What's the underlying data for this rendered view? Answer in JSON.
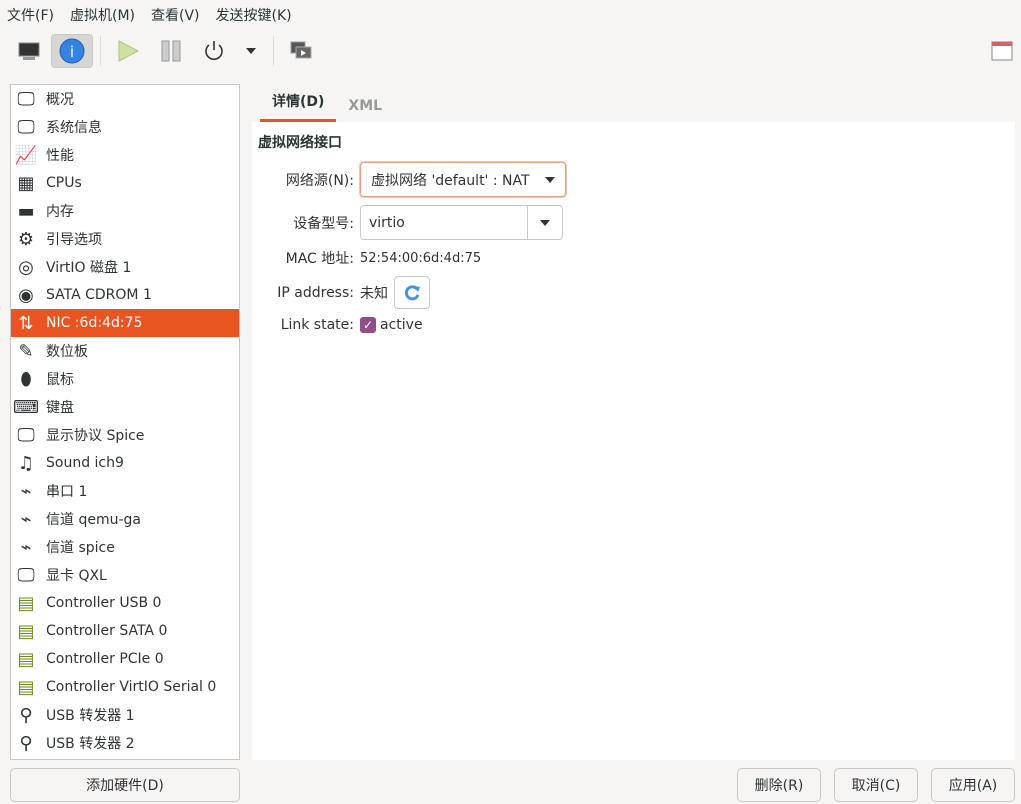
{
  "menu": [
    "文件(F)",
    "虚拟机(M)",
    "查看(V)",
    "发送按键(K)"
  ],
  "sidebar": {
    "items": [
      {
        "label": "概况",
        "icon": "monitor-icon"
      },
      {
        "label": "系统信息",
        "icon": "monitor-icon"
      },
      {
        "label": "性能",
        "icon": "performance-icon"
      },
      {
        "label": "CPUs",
        "icon": "cpu-icon"
      },
      {
        "label": "内存",
        "icon": "memory-icon"
      },
      {
        "label": "引导选项",
        "icon": "gears-icon"
      },
      {
        "label": "VirtIO 磁盘 1",
        "icon": "disk-icon"
      },
      {
        "label": "SATA CDROM 1",
        "icon": "cdrom-icon"
      },
      {
        "label": "NIC :6d:4d:75",
        "icon": "network-icon",
        "selected": true
      },
      {
        "label": "数位板",
        "icon": "tablet-icon"
      },
      {
        "label": "鼠标",
        "icon": "mouse-icon"
      },
      {
        "label": "键盘",
        "icon": "keyboard-icon"
      },
      {
        "label": "显示协议 Spice",
        "icon": "monitor-icon"
      },
      {
        "label": "Sound ich9",
        "icon": "sound-icon"
      },
      {
        "label": "串口 1",
        "icon": "serial-icon"
      },
      {
        "label": "信道 qemu-ga",
        "icon": "serial-icon"
      },
      {
        "label": "信道 spice",
        "icon": "serial-icon"
      },
      {
        "label": "显卡 QXL",
        "icon": "monitor-icon"
      },
      {
        "label": "Controller USB 0",
        "icon": "controller-icon"
      },
      {
        "label": "Controller SATA 0",
        "icon": "controller-icon"
      },
      {
        "label": "Controller PCIe 0",
        "icon": "controller-icon"
      },
      {
        "label": "Controller VirtIO Serial 0",
        "icon": "controller-icon"
      },
      {
        "label": "USB 转发器 1",
        "icon": "usb-icon"
      },
      {
        "label": "USB 转发器 2",
        "icon": "usb-icon"
      }
    ]
  },
  "add_hardware": "添加硬件(D)",
  "tabs": [
    "详情(D)",
    "XML"
  ],
  "details": {
    "heading": "虚拟网络接口",
    "source_label": "网络源(N):",
    "source_value": "虚拟网络 'default' : NAT",
    "model_label": "设备型号:",
    "model_value": "virtio",
    "mac_label": "MAC 地址:",
    "mac_value": "52:54:00:6d:4d:75",
    "ip_label": "IP address:",
    "ip_value": "未知",
    "link_label": "Link state:",
    "link_value": "active",
    "link_checked": true
  },
  "buttons": {
    "remove": "删除(R)",
    "cancel": "取消(C)",
    "apply": "应用(A)"
  },
  "colors": {
    "accent": "#e95420",
    "checkbox": "#924d8b"
  }
}
